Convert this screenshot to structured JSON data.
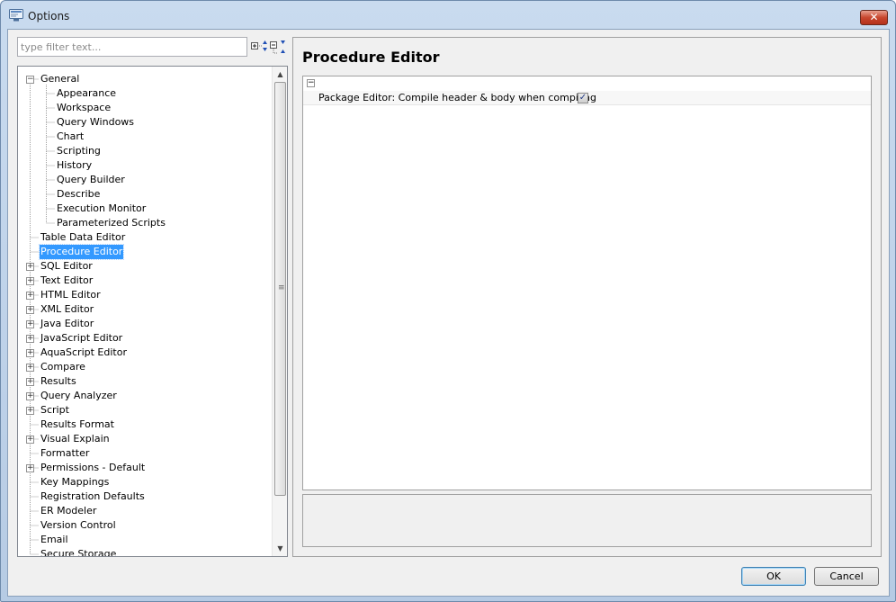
{
  "window": {
    "title": "Options",
    "close_label": "✕"
  },
  "filter": {
    "placeholder": "type filter text..."
  },
  "toolbar": {
    "expand_icon": "expand-all-icon",
    "collapse_icon": "collapse-all-icon"
  },
  "tree": {
    "items": [
      {
        "label": "General",
        "level": 0,
        "expander": "−"
      },
      {
        "label": "Appearance",
        "level": 1,
        "expander": ""
      },
      {
        "label": "Workspace",
        "level": 1,
        "expander": ""
      },
      {
        "label": "Query Windows",
        "level": 1,
        "expander": ""
      },
      {
        "label": "Chart",
        "level": 1,
        "expander": ""
      },
      {
        "label": "Scripting",
        "level": 1,
        "expander": ""
      },
      {
        "label": "History",
        "level": 1,
        "expander": ""
      },
      {
        "label": "Query Builder",
        "level": 1,
        "expander": ""
      },
      {
        "label": "Describe",
        "level": 1,
        "expander": ""
      },
      {
        "label": "Execution Monitor",
        "level": 1,
        "expander": ""
      },
      {
        "label": "Parameterized Scripts",
        "level": 1,
        "expander": ""
      },
      {
        "label": "Table Data Editor",
        "level": 0,
        "expander": ""
      },
      {
        "label": "Procedure Editor",
        "level": 0,
        "expander": "",
        "selected": true
      },
      {
        "label": "SQL Editor",
        "level": 0,
        "expander": "+"
      },
      {
        "label": "Text Editor",
        "level": 0,
        "expander": "+"
      },
      {
        "label": "HTML Editor",
        "level": 0,
        "expander": "+"
      },
      {
        "label": "XML Editor",
        "level": 0,
        "expander": "+"
      },
      {
        "label": "Java Editor",
        "level": 0,
        "expander": "+"
      },
      {
        "label": "JavaScript Editor",
        "level": 0,
        "expander": "+"
      },
      {
        "label": "AquaScript Editor",
        "level": 0,
        "expander": "+"
      },
      {
        "label": "Compare",
        "level": 0,
        "expander": "+"
      },
      {
        "label": "Results",
        "level": 0,
        "expander": "+"
      },
      {
        "label": "Query Analyzer",
        "level": 0,
        "expander": "+"
      },
      {
        "label": "Script",
        "level": 0,
        "expander": "+"
      },
      {
        "label": "Results Format",
        "level": 0,
        "expander": ""
      },
      {
        "label": "Visual Explain",
        "level": 0,
        "expander": "+"
      },
      {
        "label": "Formatter",
        "level": 0,
        "expander": ""
      },
      {
        "label": "Permissions - Default",
        "level": 0,
        "expander": "+"
      },
      {
        "label": "Key Mappings",
        "level": 0,
        "expander": ""
      },
      {
        "label": "Registration Defaults",
        "level": 0,
        "expander": ""
      },
      {
        "label": "ER Modeler",
        "level": 0,
        "expander": ""
      },
      {
        "label": "Version Control",
        "level": 0,
        "expander": ""
      },
      {
        "label": "Email",
        "level": 0,
        "expander": ""
      },
      {
        "label": "Secure Storage",
        "level": 0,
        "expander": ""
      }
    ]
  },
  "page": {
    "title": "Procedure Editor",
    "section_toggle": "−",
    "properties": [
      {
        "label": "Package Editor: Compile header & body when compiling",
        "checked": true,
        "check_glyph": "✓"
      }
    ]
  },
  "buttons": {
    "ok": "OK",
    "cancel": "Cancel"
  }
}
